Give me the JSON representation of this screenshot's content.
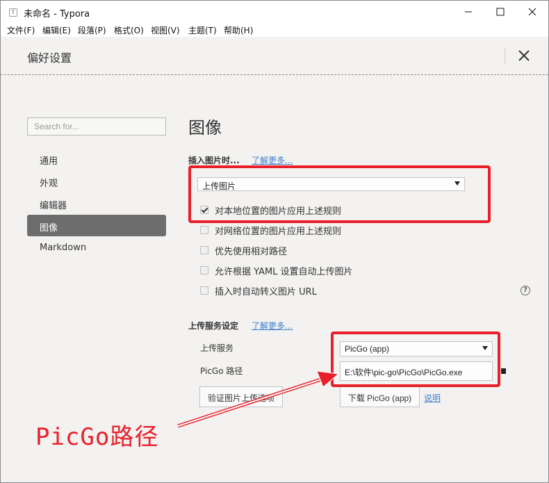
{
  "window": {
    "app_icon": "T",
    "title": "未命名 - Typora"
  },
  "menu": [
    "文件(F)",
    "编辑(E)",
    "段落(P)",
    "格式(O)",
    "视图(V)",
    "主题(T)",
    "帮助(H)"
  ],
  "preferences": {
    "title": "偏好设置",
    "search_placeholder": "Search for...",
    "nav": [
      {
        "label": "通用",
        "active": false
      },
      {
        "label": "外观",
        "active": false
      },
      {
        "label": "编辑器",
        "active": false
      },
      {
        "label": "图像",
        "active": true
      },
      {
        "label": "Markdown",
        "active": false
      }
    ]
  },
  "image_section": {
    "title": "图像",
    "insert_heading": "插入图片时...",
    "learn_more": "了解更多...",
    "insert_action": "上传图片",
    "options": [
      {
        "label": "对本地位置的图片应用上述规则",
        "checked": true
      },
      {
        "label": "对网络位置的图片应用上述规则",
        "checked": false
      },
      {
        "label": "优先使用相对路径",
        "checked": false
      },
      {
        "label": "允许根据 YAML 设置自动上传图片",
        "checked": false
      },
      {
        "label": "插入时自动转义图片 URL",
        "checked": false
      }
    ],
    "help_icon": "?"
  },
  "upload": {
    "heading": "上传服务设定",
    "learn_more": "了解更多...",
    "service_label": "上传服务",
    "service_value": "PicGo (app)",
    "path_label": "PicGo 路径",
    "path_value": "E:\\软件\\pic-go\\PicGo\\PicGo.exe",
    "verify_button": "验证图片上传选项",
    "download_button": "下载 PicGo (app)",
    "explain_link": "说明"
  },
  "annotation": {
    "text": "PicGo路径",
    "color": "#e8202a"
  },
  "colors": {
    "accent_link": "#3f7fd0",
    "nav_active": "#6d6d6d",
    "panel_bg": "#f3f2f0"
  }
}
